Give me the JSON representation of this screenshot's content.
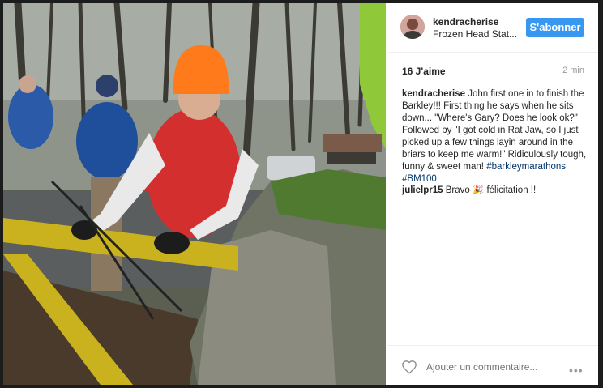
{
  "post": {
    "username": "kendracherise",
    "location": "Frozen Head Stat...",
    "follow_label": "S'abonner",
    "likes": "16 J'aime",
    "time_ago": "2 min",
    "caption_user": "kendracherise",
    "caption_text": " John first one in to finish the Barkley!!! First thing he says when he sits down... \"Where's Gary? Does he look ok?\" Followed by \"I got cold in Rat Jaw, so I just picked up a few things layin around in the briars to keep me warm!\" Ridiculously tough, funny & sweet man!",
    "hashtag1": "#barkleymarathons",
    "hashtag2": "#BM100",
    "comment_user": "julielpr15",
    "comment_text": " Bravo 🎉 félicitation !!",
    "add_comment_placeholder": "Ajouter un commentaire...",
    "more_label": "•••"
  },
  "colors": {
    "follow_button": "#3897f0",
    "hashtag": "#003569"
  },
  "icons": {
    "like": "heart-icon",
    "options": "more-options-icon"
  }
}
